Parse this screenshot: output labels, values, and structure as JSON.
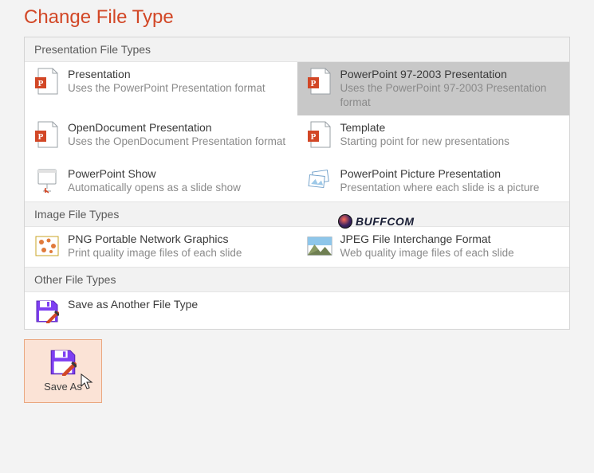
{
  "page_title": "Change File Type",
  "sections": {
    "presentation": {
      "header": "Presentation File Types",
      "items": [
        {
          "title": "Presentation",
          "desc": "Uses the PowerPoint Presentation format"
        },
        {
          "title": "PowerPoint 97-2003 Presentation",
          "desc": "Uses the PowerPoint 97-2003 Presentation format"
        },
        {
          "title": "OpenDocument Presentation",
          "desc": "Uses the OpenDocument Presentation format"
        },
        {
          "title": "Template",
          "desc": "Starting point for new presentations"
        },
        {
          "title": "PowerPoint Show",
          "desc": "Automatically opens as a slide show"
        },
        {
          "title": "PowerPoint Picture Presentation",
          "desc": "Presentation where each slide is a picture"
        }
      ]
    },
    "image": {
      "header": "Image File Types",
      "items": [
        {
          "title": "PNG Portable Network Graphics",
          "desc": "Print quality image files of each slide"
        },
        {
          "title": "JPEG File Interchange Format",
          "desc": "Web quality image files of each slide"
        }
      ]
    },
    "other": {
      "header": "Other File Types",
      "items": [
        {
          "title": "Save as Another File Type",
          "desc": ""
        }
      ]
    }
  },
  "save_as_button": "Save As",
  "watermark_text": "BUFFCOM"
}
